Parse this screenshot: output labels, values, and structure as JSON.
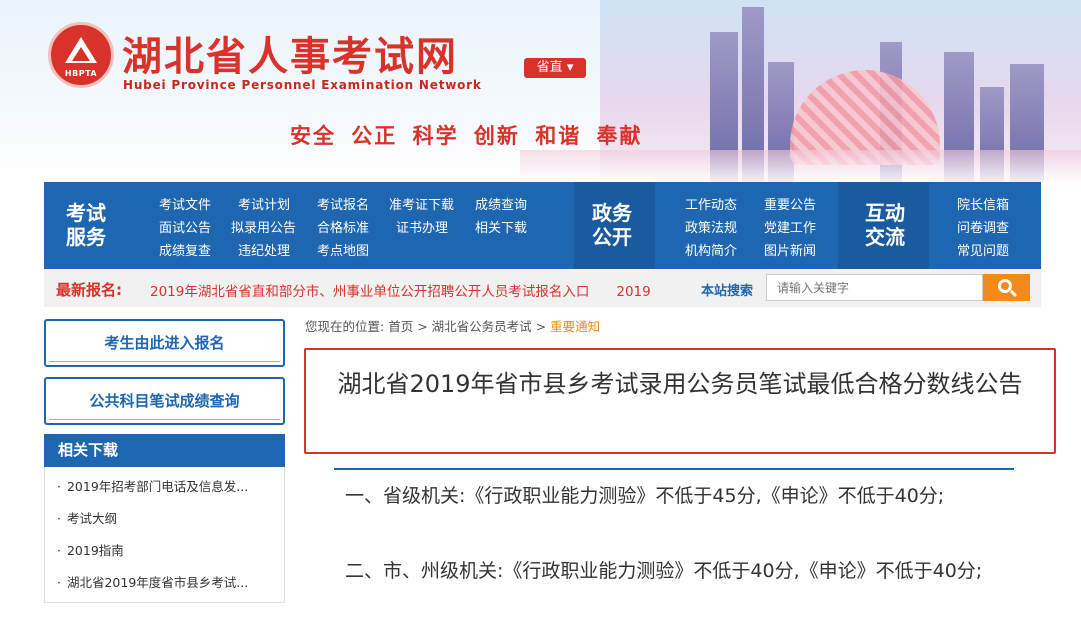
{
  "header": {
    "logo_abbr": "HBPTA",
    "title": "湖北省人事考试网",
    "title_en": "Hubei Province Personnel Examination Network",
    "region": "省直",
    "slogan": "安全 公正 科学 创新 和谐 奉献"
  },
  "nav": {
    "sections": [
      {
        "title": "考试\n服务",
        "links": [
          "考试文件",
          "考试计划",
          "考试报名",
          "准考证下载",
          "成绩查询",
          "面试公告",
          "拟录用公告",
          "合格标准",
          "证书办理",
          "相关下载",
          "成绩复查",
          "违纪处理",
          "考点地图"
        ]
      },
      {
        "title": "政务\n公开",
        "links": [
          "工作动态",
          "重要公告",
          "政策法规",
          "党建工作",
          "机构简介",
          "图片新闻"
        ]
      },
      {
        "title": "互动\n交流",
        "links": [
          "院长信箱",
          "问卷调查",
          "常见问题"
        ]
      }
    ]
  },
  "newsbar": {
    "label": "最新报名:",
    "text": "2019年湖北省省直和部分市、州事业单位公开招聘公开人员考试报名入口　　2019",
    "search_label": "本站搜索",
    "search_placeholder": "请输入关键字"
  },
  "sidebar": {
    "buttons": [
      "考生由此进入报名",
      "公共科目笔试成绩查询"
    ],
    "downloads_title": "相关下载",
    "downloads": [
      "2019年招考部门电话及信息发...",
      "考试大纲",
      "2019指南",
      "湖北省2019年度省市县乡考试..."
    ]
  },
  "breadcrumb": {
    "prefix": "您现在的位置:",
    "home": "首页",
    "sep": ">",
    "section": "湖北省公务员考试",
    "current": "重要通知"
  },
  "article": {
    "title": "湖北省2019年省市县乡考试录用公务员笔试最低合格分数线公告",
    "paragraphs": [
      "一、省级机关:《行政职业能力测验》不低于45分,《申论》不低于40分;",
      "二、市、州级机关:《行政职业能力测验》不低于40分,《申论》不低于40分;"
    ]
  },
  "colors": {
    "brand_red": "#d9322a",
    "brand_blue": "#1f66b1",
    "accent_orange": "#f28a1b"
  }
}
